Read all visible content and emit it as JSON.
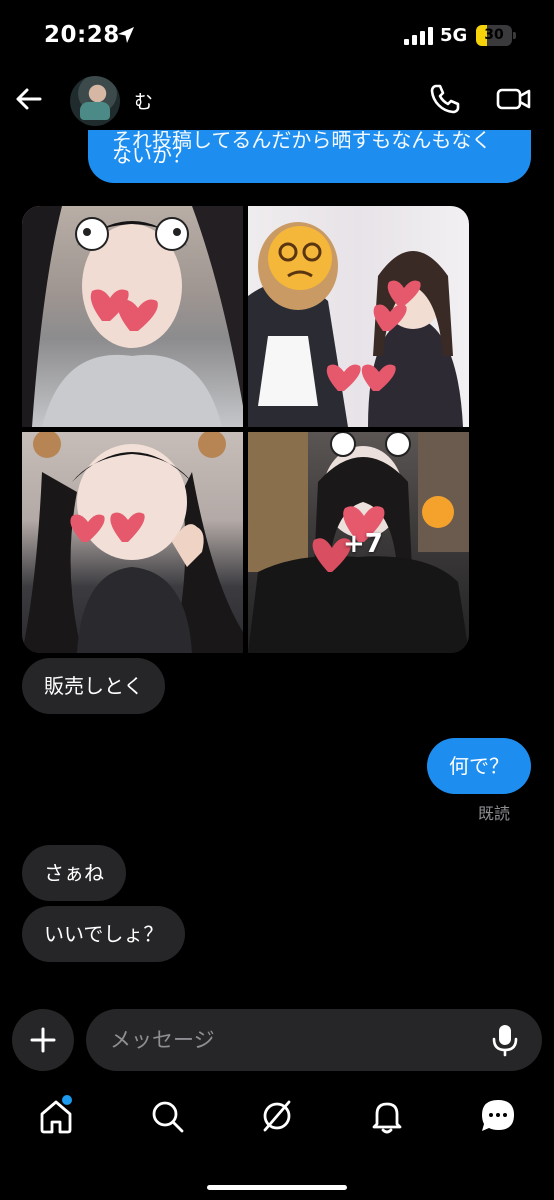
{
  "status_bar": {
    "time": "20:28",
    "network": "5G",
    "battery_percent": 30,
    "battery_label": "30",
    "battery_color": "#f5d20a",
    "icons": [
      "location-arrow-icon",
      "signal-icon"
    ]
  },
  "header": {
    "contact_name": "む",
    "icons": [
      "back-arrow-icon",
      "phone-icon",
      "video-camera-icon"
    ]
  },
  "messages": {
    "outgoing_partial_line": "それ投稿してるんだから晒すもなんもなく",
    "outgoing_partial_text": "ないか？",
    "photo_grid_more": "+7",
    "incoming_1": "販売しとく",
    "outgoing_1": "何で？",
    "read_receipt": "既読",
    "incoming_2": "さぁね",
    "incoming_3": "いいでしょ？"
  },
  "composer": {
    "placeholder": "メッセージ",
    "icons": [
      "plus-icon",
      "microphone-icon"
    ]
  },
  "tabbar": {
    "icons": [
      "home-icon",
      "search-icon",
      "explore-icon",
      "bell-icon",
      "messages-icon"
    ],
    "accent": "#1d9bf0"
  },
  "colors": {
    "outgoing_bubble": "#1d8ef0",
    "incoming_bubble": "#262628",
    "background": "#000000"
  }
}
